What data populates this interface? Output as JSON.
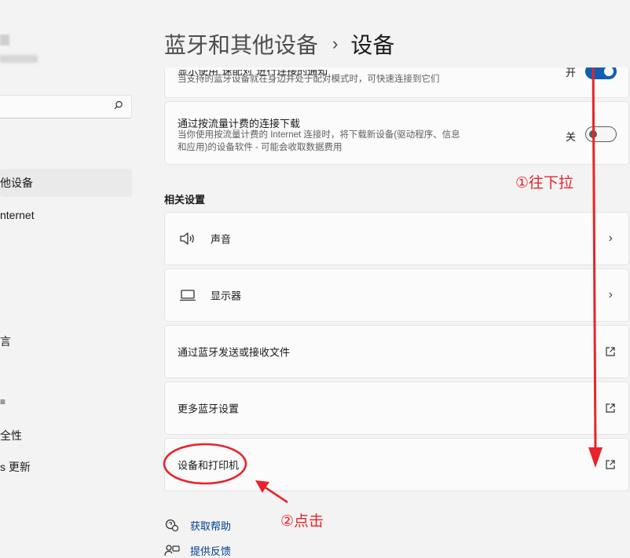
{
  "sidebar": {
    "items": [
      {
        "label": "他设备",
        "selected": true
      },
      {
        "label": "nternet"
      },
      {
        "label": "言"
      },
      {
        "label": "≡"
      },
      {
        "label": "全性"
      },
      {
        "label": "s 更新"
      }
    ]
  },
  "header": {
    "parent": "蓝牙和其他设备",
    "separator": "›",
    "current": "设备"
  },
  "settings": {
    "swift_pair": {
      "title_partial": "显示使用\"速配对\"进行连接的通知",
      "desc": "当支持的蓝牙设备就在身边并处于配对模式时，可快速连接到它们",
      "state_label": "开",
      "on": true
    },
    "metered": {
      "title": "通过按流量计费的连接下载",
      "desc_line1": "当你使用按流量计费的 Internet 连接时，将下载新设备(驱动程序、信息",
      "desc_line2": "和应用)的设备软件 - 可能会收取数据费用",
      "state_label": "关",
      "on": false
    }
  },
  "related": {
    "heading": "相关设置",
    "items": [
      {
        "label": "声音",
        "icon": "speaker-icon",
        "action": "chevron"
      },
      {
        "label": "显示器",
        "icon": "laptop-icon",
        "action": "chevron"
      },
      {
        "label": "通过蓝牙发送或接收文件",
        "action": "external"
      },
      {
        "label": "更多蓝牙设置",
        "action": "external"
      },
      {
        "label": "设备和打印机",
        "action": "external"
      }
    ]
  },
  "footer_links": [
    {
      "label": "获取帮助",
      "icon": "help-icon"
    },
    {
      "label": "提供反馈",
      "icon": "feedback-icon"
    }
  ],
  "annotations": {
    "step1": "①往下拉",
    "step2": "②点击",
    "color": "#e8242a"
  },
  "chevron_glyph": "›",
  "colors": {
    "accent": "#0f5fb3",
    "link": "#003e92",
    "background": "#f3f3f3",
    "card": "#fbfbfb"
  }
}
